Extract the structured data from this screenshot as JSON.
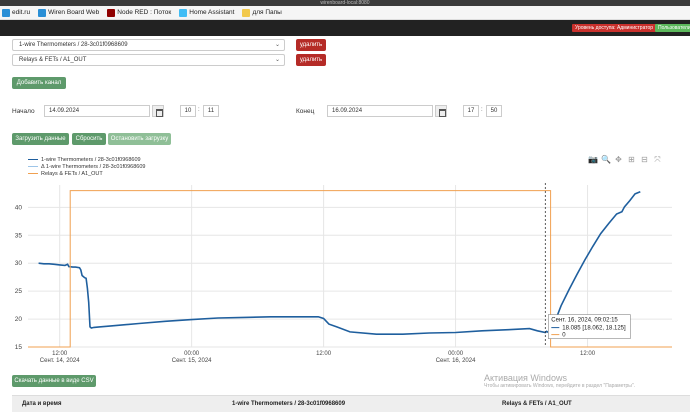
{
  "window": {
    "title": "wirenboard-local:8080"
  },
  "bookmarks": [
    {
      "label": "edit.ru",
      "color": "#2a8fd6",
      "icon": "web-icon"
    },
    {
      "label": "Wiren Board Web",
      "color": "#2a8fd6",
      "icon": "web-icon"
    },
    {
      "label": "Node RED : Поток",
      "color": "#8f0000",
      "icon": "node-red-icon"
    },
    {
      "label": "Home Assistant",
      "color": "#41bdf5",
      "icon": "home-assistant-icon"
    },
    {
      "label": "для Папы",
      "color": "#f2c94c",
      "icon": "folder-icon"
    }
  ],
  "header": {
    "access_badge": "Уровень доступа: Администратор",
    "account_button": "Пользователи"
  },
  "channels": [
    {
      "value": "1-wire Thermometers / 28-3c01f0968609",
      "delete_label": "удалить"
    },
    {
      "value": "Relays & FETs / A1_OUT",
      "delete_label": "удалить"
    }
  ],
  "add_channel_button": "Добавить канал",
  "range": {
    "start_label": "Начало",
    "start_date": "14.09.2024",
    "start_hour": "10",
    "start_min": "11",
    "end_label": "Конец",
    "end_date": "16.09.2024",
    "end_hour": "17",
    "end_min": "50",
    "time_sep": ":"
  },
  "actions": {
    "load": "Загрузить данные",
    "reset": "Сбросить",
    "stop": "Остановить загрузку"
  },
  "modebar": [
    "camera-icon",
    "zoom-icon",
    "pan-icon",
    "zoom-in-icon",
    "zoom-out-icon",
    "autoscale-icon"
  ],
  "modebar_glyphs": [
    "📷",
    "🔍",
    "✥",
    "⊞",
    "⊟",
    "⤧"
  ],
  "colors": {
    "series_temp": "#1f5f9e",
    "series_temp_delta": "#9ec5e8",
    "series_relay": "#f0a050",
    "cursor": "#333333",
    "tooltip_line": "#1f5f9e"
  },
  "chart_data": {
    "type": "line",
    "x_ticks": [
      {
        "t": 0.5,
        "label": "12:00",
        "sub": "Сент. 14, 2024"
      },
      {
        "t": 1.0,
        "label": "00:00",
        "sub": "Сент. 15, 2024"
      },
      {
        "t": 1.5,
        "label": "12:00",
        "sub": ""
      },
      {
        "t": 2.0,
        "label": "00:00",
        "sub": "Сент. 16, 2024"
      },
      {
        "t": 2.5,
        "label": "12:00",
        "sub": ""
      }
    ],
    "y_ticks": [
      15,
      20,
      25,
      30,
      35,
      40
    ],
    "ylim": [
      15,
      44
    ],
    "xlim": [
      0.38,
      2.82
    ],
    "grid": true,
    "series": [
      {
        "name": "1-wire Thermometers / 28-3c01f0968609",
        "color": "#1f5f9e",
        "x": [
          0.42,
          0.44,
          0.46,
          0.48,
          0.5,
          0.52,
          0.53,
          0.535,
          0.55,
          0.56,
          0.575,
          0.58,
          0.585,
          0.595,
          0.6,
          0.605,
          0.61,
          0.615,
          0.62,
          0.63,
          0.65,
          0.7,
          0.8,
          0.9,
          1.0,
          1.1,
          1.2,
          1.3,
          1.4,
          1.45,
          1.48,
          1.5,
          1.52,
          1.55,
          1.6,
          1.7,
          1.8,
          1.9,
          2.0,
          2.1,
          2.2,
          2.28,
          2.31,
          2.34,
          2.345,
          2.36,
          2.38,
          2.4,
          2.43,
          2.46,
          2.49,
          2.52,
          2.55,
          2.58,
          2.61,
          2.63,
          2.64,
          2.66,
          2.68,
          2.7
        ],
        "y": [
          30.0,
          29.9,
          29.9,
          29.8,
          29.7,
          29.6,
          29.8,
          29.4,
          29.3,
          29.3,
          29.2,
          28.8,
          27.8,
          27.4,
          27.3,
          25.5,
          23.0,
          18.6,
          18.4,
          18.5,
          18.6,
          18.8,
          19.2,
          19.6,
          19.9,
          20.2,
          20.3,
          20.4,
          20.4,
          20.4,
          20.4,
          20.1,
          19.1,
          18.6,
          17.7,
          17.3,
          17.3,
          17.5,
          17.6,
          17.9,
          18.1,
          18.3,
          17.9,
          17.6,
          17.8,
          17.4,
          20.0,
          22.4,
          25.3,
          28.0,
          30.6,
          33.0,
          35.3,
          37.1,
          38.8,
          39.2,
          40.1,
          41.2,
          42.4,
          42.8
        ]
      },
      {
        "name": "Δ 1-wire Thermometers / 28-3c01f0968609",
        "color": "#9ec5e8",
        "x": [],
        "y": []
      },
      {
        "name": "Relays & FETs / A1_OUT",
        "color": "#f0a050",
        "x": [
          0.38,
          0.54,
          0.54,
          2.36,
          2.36,
          2.82
        ],
        "y": [
          15,
          15,
          43.0,
          43.0,
          15,
          15
        ]
      }
    ],
    "cursor_x": 2.34,
    "tooltip": {
      "title": "Сент. 16, 2024, 09:02:15",
      "line1": "18.085 [18.062, 18.125]",
      "line2": "0"
    }
  },
  "download_button": "Скачать данные в виде CSV",
  "watermark": {
    "line1": "Активация Windows",
    "line2": "Чтобы активировать Windows, перейдите в раздел \"Параметры\"."
  },
  "table": {
    "col_datetime": "Дата и время",
    "col_temp": "1-wire Thermometers / 28-3c01f0968609",
    "col_relay": "Relays & FETs / A1_OUT"
  }
}
